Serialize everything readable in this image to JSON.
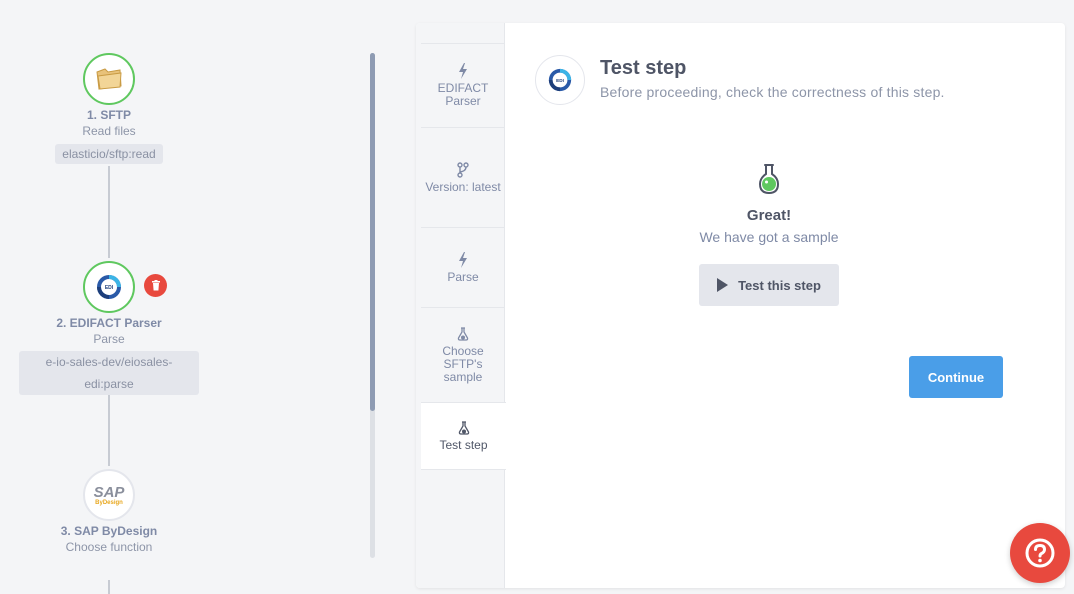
{
  "flow": {
    "steps": [
      {
        "title": "1. SFTP",
        "subtitle": "Read files",
        "tag": "elasticio/sftp:read"
      },
      {
        "title": "2. EDIFACT Parser",
        "subtitle": "Parse",
        "tag": "e-io-sales-dev/eiosales-edi:parse"
      },
      {
        "title": "3. SAP ByDesign",
        "subtitle": "Choose function",
        "logo_text": "SAP",
        "logo_sub": "ByDesign"
      }
    ]
  },
  "tabs": [
    {
      "label": "EDIFACT Parser",
      "icon": "lightning-icon"
    },
    {
      "label": "Version: latest",
      "icon": "branch-icon"
    },
    {
      "label": "Parse",
      "icon": "lightning-icon"
    },
    {
      "label": "Choose SFTP's sample",
      "icon": "flask-icon"
    },
    {
      "label": "Test step",
      "icon": "flask-icon",
      "active": true
    }
  ],
  "header": {
    "title": "Test step",
    "description": "Before proceeding, check the correctness of this step."
  },
  "result": {
    "title": "Great!",
    "message": "We have got a sample",
    "test_button": "Test this step"
  },
  "continue_label": "Continue",
  "colors": {
    "success": "#5fc85f",
    "danger": "#e8493e",
    "primary": "#4a9ee8"
  }
}
